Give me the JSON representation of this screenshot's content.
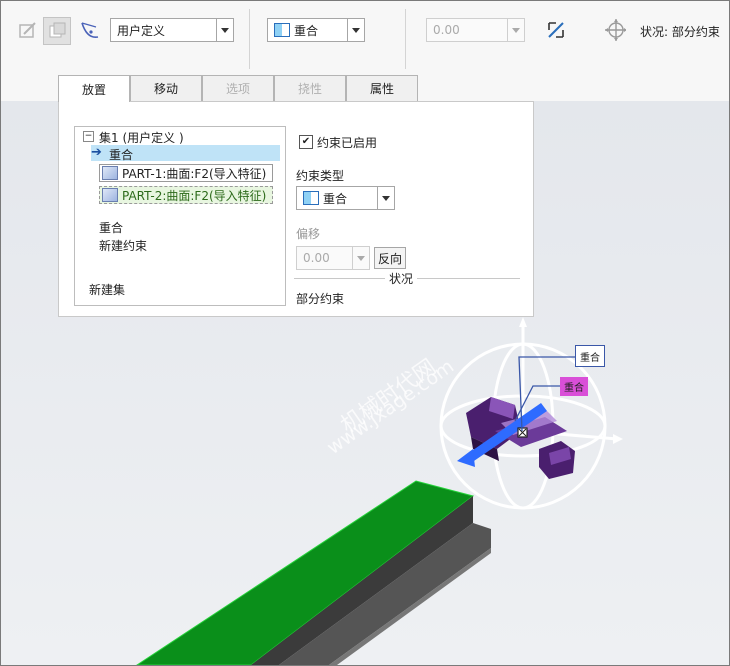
{
  "toolbar": {
    "constraint_set_type": "用户定义",
    "constraint_type": "重合",
    "offset_value": "0.00",
    "status_text": "状况: 部分约束"
  },
  "tabs": [
    {
      "label": "放置",
      "state": "active"
    },
    {
      "label": "移动",
      "state": "normal"
    },
    {
      "label": "选项",
      "state": "disabled"
    },
    {
      "label": "挠性",
      "state": "disabled"
    },
    {
      "label": "属性",
      "state": "normal"
    }
  ],
  "placement": {
    "tree": {
      "set_label": "集1 (用户定义 )",
      "selected_constraint": "重合",
      "refs": [
        "PART-1:曲面:F2(导入特征)",
        "PART-2:曲面:F2(导入特征)"
      ],
      "constraint": "重合",
      "new_constraint": "新建约束",
      "new_set": "新建集"
    },
    "enabled_label": "约束已启用",
    "constraint_type_label": "约束类型",
    "constraint_type_value": "重合",
    "offset_label": "偏移",
    "offset_value": "0.00",
    "flip_button": "反向",
    "status_heading": "状况",
    "status_value": "部分约束"
  },
  "viewport": {
    "tag_1": "重合",
    "tag_2": "重合",
    "watermark_line1": "机械时代网",
    "watermark_line2": "www.jxage.com"
  },
  "colors": {
    "highlight": "#bfe3f7",
    "green_face": "#0a8f1a",
    "part_purple": "#5a2a7e",
    "tag_magenta": "#d94fd8",
    "dragger_blue": "#2e6bff"
  }
}
